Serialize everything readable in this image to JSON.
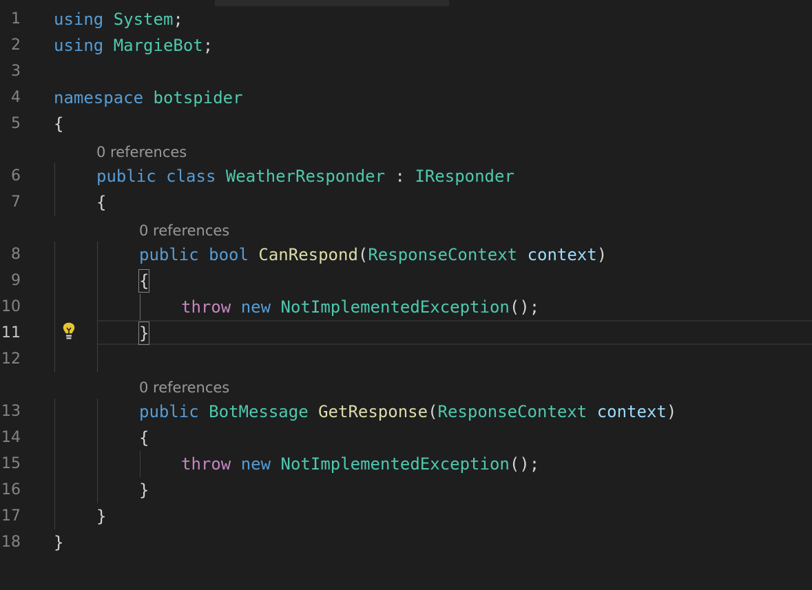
{
  "editor": {
    "lightbulb_icon": "lightbulb-icon",
    "lines": [
      {
        "n": "1"
      },
      {
        "n": "2"
      },
      {
        "n": "3"
      },
      {
        "n": "4"
      },
      {
        "n": "5"
      },
      {
        "n": "6"
      },
      {
        "n": "7"
      },
      {
        "n": "8"
      },
      {
        "n": "9"
      },
      {
        "n": "10"
      },
      {
        "n": "11"
      },
      {
        "n": "12"
      },
      {
        "n": "13"
      },
      {
        "n": "14"
      },
      {
        "n": "15"
      },
      {
        "n": "16"
      },
      {
        "n": "17"
      },
      {
        "n": "18"
      }
    ],
    "code": {
      "l1": {
        "using": "using",
        "name": "System",
        "semi": ";"
      },
      "l2": {
        "using": "using",
        "name": "MargieBot",
        "semi": ";"
      },
      "l4": {
        "kw": "namespace",
        "name": "botspider"
      },
      "l5": {
        "brace": "{"
      },
      "lens_class": "0 references",
      "l6": {
        "public": "public",
        "class": "class",
        "name": "WeatherResponder",
        "colon": " : ",
        "iface": "IResponder"
      },
      "l7": {
        "brace": "{"
      },
      "lens_canrespond": "0 references",
      "l8": {
        "public": "public",
        "type": "bool",
        "method": "CanRespond",
        "open": "(",
        "ptype": "ResponseContext",
        "param": "context",
        "close": ")"
      },
      "l9": {
        "brace": "{"
      },
      "l10": {
        "throw": "throw",
        "new": "new",
        "exc": "NotImplementedException",
        "tail": "();"
      },
      "l11": {
        "brace": "}"
      },
      "lens_getresponse": "0 references",
      "l13": {
        "public": "public",
        "type": "BotMessage",
        "method": "GetResponse",
        "open": "(",
        "ptype": "ResponseContext",
        "param": "context",
        "close": ")"
      },
      "l14": {
        "brace": "{"
      },
      "l15": {
        "throw": "throw",
        "new": "new",
        "exc": "NotImplementedException",
        "tail": "();"
      },
      "l16": {
        "brace": "}"
      },
      "l17": {
        "brace": "}"
      },
      "l18": {
        "brace": "}"
      }
    },
    "colors": {
      "background": "#1e1e1e",
      "keyword": "#569cd6",
      "type": "#4ec9b0",
      "method": "#dcdcaa",
      "parameter": "#9cdcfe",
      "control": "#c586c0",
      "lightbulb": "#e8c531"
    }
  }
}
